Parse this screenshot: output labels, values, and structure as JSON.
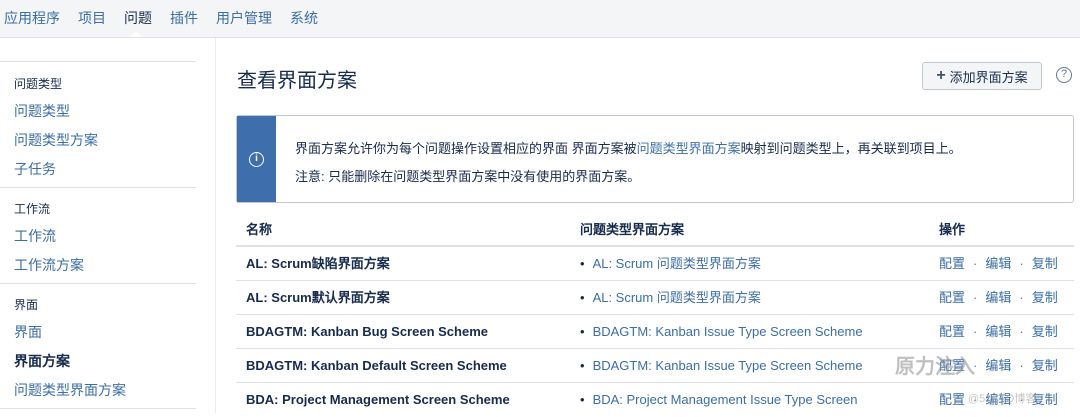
{
  "topnav": {
    "tabs": [
      {
        "label": "应用程序"
      },
      {
        "label": "项目"
      },
      {
        "label": "问题",
        "active": true
      },
      {
        "label": "插件"
      },
      {
        "label": "用户管理"
      },
      {
        "label": "系统"
      }
    ]
  },
  "sidebar": {
    "groups": [
      {
        "title": "问题类型",
        "items": [
          "问题类型",
          "问题类型方案",
          "子任务"
        ]
      },
      {
        "title": "工作流",
        "items": [
          "工作流",
          "工作流方案"
        ]
      },
      {
        "title": "界面",
        "items": [
          "界面",
          "界面方案",
          "问题类型界面方案"
        ]
      }
    ],
    "selected": "界面方案"
  },
  "main": {
    "title": "查看界面方案",
    "add_button": "添加界面方案",
    "help_icon": "question-circle-icon",
    "info": {
      "icon": "info-circle-icon",
      "line1_prefix": "界面方案允许你为每个问题操作设置相应的界面 界面方案被",
      "line1_link": "问题类型界面方案",
      "line1_suffix": "映射到问题类型上，再关联到项目上。",
      "line2": "注意: 只能删除在问题类型界面方案中没有使用的界面方案。"
    },
    "table": {
      "headers": {
        "name": "名称",
        "scheme": "问题类型界面方案",
        "ops": "操作"
      },
      "ops_labels": {
        "config": "配置",
        "edit": "编辑",
        "copy": "复制",
        "sep": "·"
      },
      "rows": [
        {
          "name": "AL: Scrum缺陷界面方案",
          "scheme": "AL: Scrum 问题类型界面方案"
        },
        {
          "name": "AL: Scrum默认界面方案",
          "scheme": "AL: Scrum 问题类型界面方案"
        },
        {
          "name": "BDAGTM: Kanban Bug Screen Scheme",
          "scheme": "BDAGTM: Kanban Issue Type Screen Scheme"
        },
        {
          "name": "BDAGTM: Kanban Default Screen Scheme",
          "scheme": "BDAGTM: Kanban Issue Type Screen Scheme"
        },
        {
          "name": "BDA: Project Management Screen Scheme",
          "scheme": "BDA: Project Management Issue Type Screen"
        }
      ]
    }
  },
  "colors": {
    "link": "#3b6ea5",
    "info_stripe": "#3f6ead",
    "text": "#172b4d"
  },
  "watermark": {
    "main": "原力注入",
    "sub": "@51CTO博客"
  }
}
